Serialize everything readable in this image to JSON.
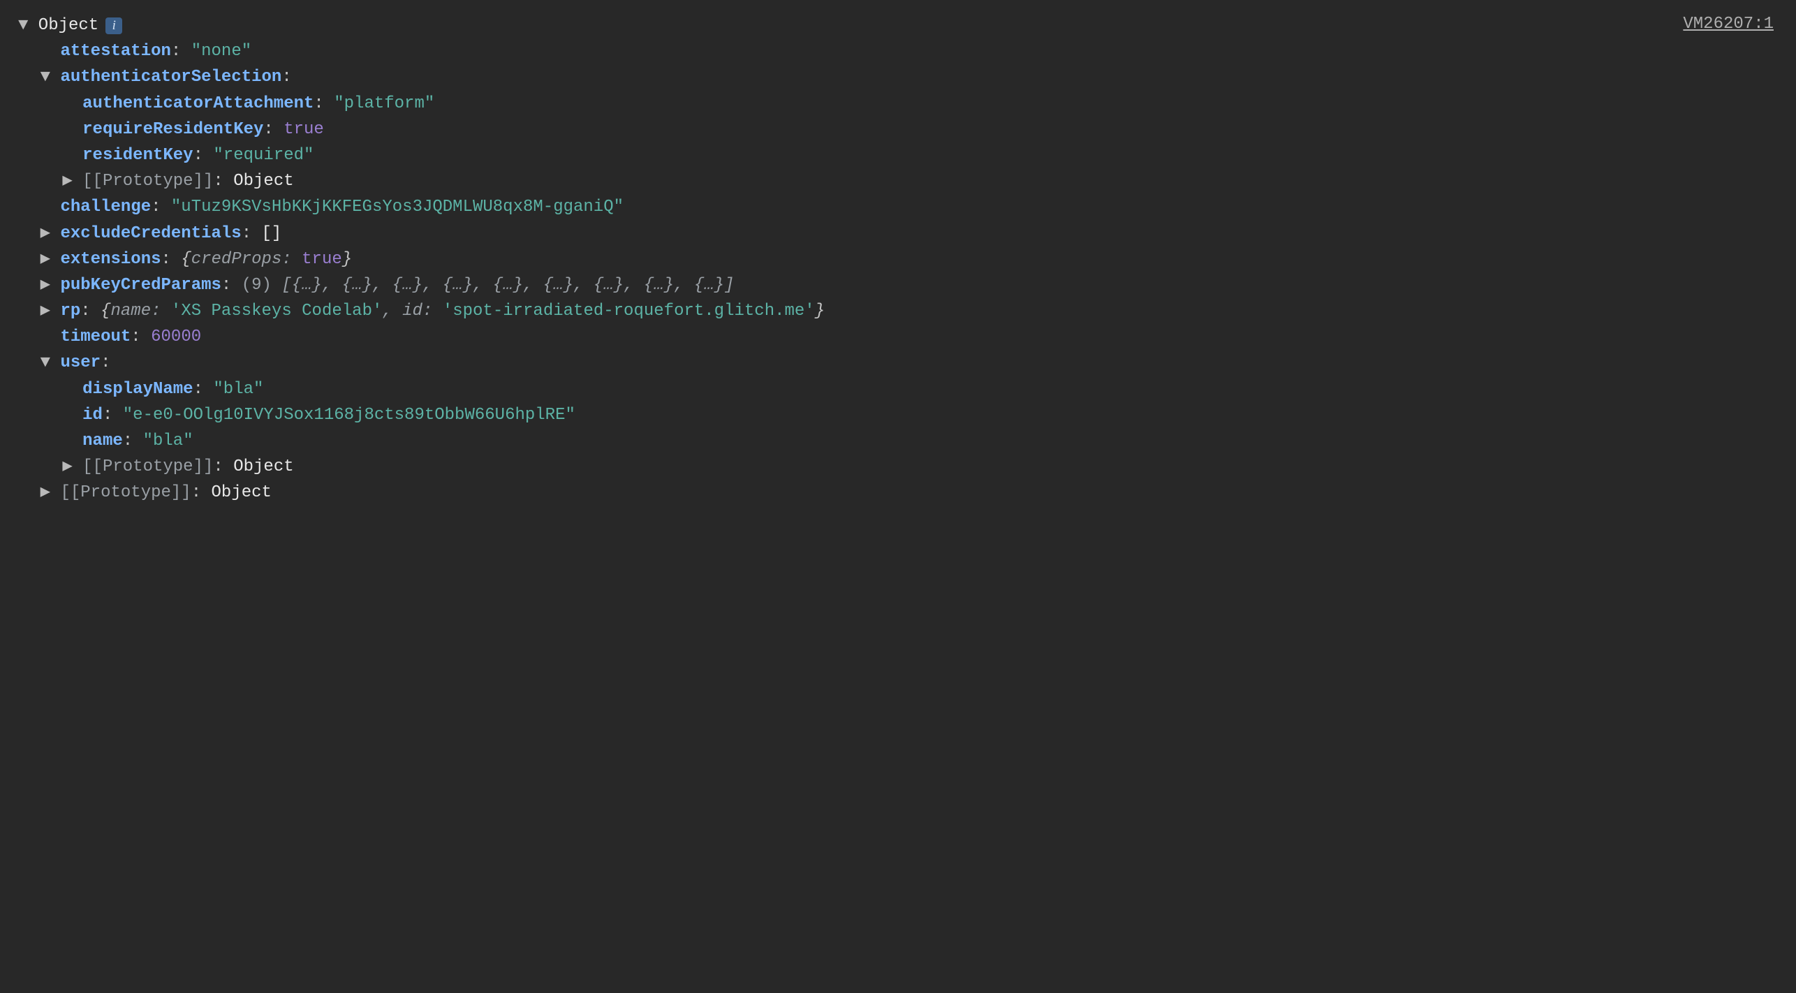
{
  "sourceLink": "VM26207:1",
  "root": {
    "label": "Object",
    "info_glyph": "i"
  },
  "props": {
    "attestation": {
      "key": "attestation",
      "value": "\"none\""
    },
    "authenticatorSelection": {
      "key": "authenticatorSelection",
      "authenticatorAttachment": {
        "key": "authenticatorAttachment",
        "value": "\"platform\""
      },
      "requireResidentKey": {
        "key": "requireResidentKey",
        "value": "true"
      },
      "residentKey": {
        "key": "residentKey",
        "value": "\"required\""
      },
      "proto": {
        "key": "[[Prototype]]",
        "value": "Object"
      }
    },
    "challenge": {
      "key": "challenge",
      "value": "\"uTuz9KSVsHbKKjKKFEGsYos3JQDMLWU8qx8M-gganiQ\""
    },
    "excludeCredentials": {
      "key": "excludeCredentials",
      "value": "[]"
    },
    "extensions": {
      "key": "extensions",
      "preview_open": "{",
      "inner_key": "credProps",
      "inner_val": "true",
      "preview_close": "}"
    },
    "pubKeyCredParams": {
      "key": "pubKeyCredParams",
      "count": "(9)",
      "preview": "[{…}, {…}, {…}, {…}, {…}, {…}, {…}, {…}, {…}]"
    },
    "rp": {
      "key": "rp",
      "preview_open": "{",
      "name_key": "name",
      "name_val": "'XS Passkeys Codelab'",
      "sep": ", ",
      "id_key": "id",
      "id_val": "'spot-irradiated-roquefort.glitch.me'",
      "preview_close": "}"
    },
    "timeout": {
      "key": "timeout",
      "value": "60000"
    },
    "user": {
      "key": "user",
      "displayName": {
        "key": "displayName",
        "value": "\"bla\""
      },
      "id": {
        "key": "id",
        "value": "\"e-e0-OOlg10IVYJSox1168j8cts89tObbW66U6hplRE\""
      },
      "name": {
        "key": "name",
        "value": "\"bla\""
      },
      "proto": {
        "key": "[[Prototype]]",
        "value": "Object"
      }
    },
    "proto": {
      "key": "[[Prototype]]",
      "value": "Object"
    }
  },
  "tri": {
    "down": "▼",
    "right": "▶"
  }
}
